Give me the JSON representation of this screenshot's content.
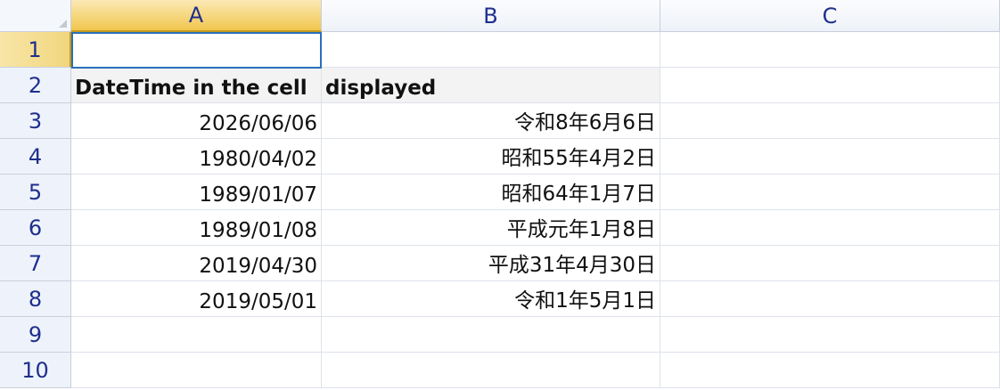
{
  "columns": [
    "A",
    "B",
    "C"
  ],
  "rows": [
    "1",
    "2",
    "3",
    "4",
    "5",
    "6",
    "7",
    "8",
    "9",
    "10"
  ],
  "cells": {
    "A1": "",
    "B1": "",
    "C1": "",
    "A2": "DateTime in the cell",
    "B2": "displayed",
    "C2": "",
    "A3": "2026/06/06",
    "B3": "令和8年6月6日",
    "C3": "",
    "A4": "1980/04/02",
    "B4": "昭和55年4月2日",
    "C4": "",
    "A5": "1989/01/07",
    "B5": "昭和64年1月7日",
    "C5": "",
    "A6": "1989/01/08",
    "B6": "平成元年1月8日",
    "C6": "",
    "A7": "2019/04/30",
    "B7": "平成31年4月30日",
    "C7": "",
    "A8": "2019/05/01",
    "B8": "令和1年5月1日",
    "C8": "",
    "A9": "",
    "B9": "",
    "C9": "",
    "A10": "",
    "B10": "",
    "C10": ""
  },
  "active_cell": "A1",
  "colors": {
    "header_text": "#1f2f8c",
    "active_header": "#f1c64e",
    "selection_border": "#2a6fba",
    "header_row_fill": "#f3f3f3"
  }
}
